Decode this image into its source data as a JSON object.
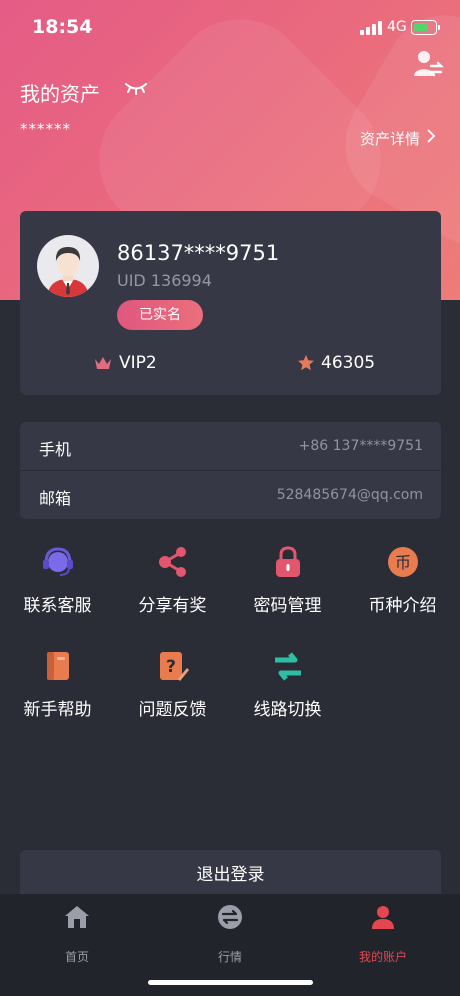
{
  "status_bar": {
    "time": "18:54",
    "network": "4G"
  },
  "header": {
    "title": "我的资产",
    "hidden_amount": "******",
    "detail_link": "资产详情"
  },
  "profile": {
    "phone": "86137****9751",
    "uid": "UID 136994",
    "verified_label": "已实名",
    "vip_level": "VIP2",
    "points": "46305"
  },
  "info_rows": [
    {
      "label": "手机",
      "value": "+86 137****9751"
    },
    {
      "label": "邮箱",
      "value": "528485674@qq.com"
    }
  ],
  "menu": [
    {
      "label": "联系客服",
      "icon": "headset-icon",
      "color": "#7b6be8"
    },
    {
      "label": "分享有奖",
      "icon": "share-icon",
      "color": "#e2566e"
    },
    {
      "label": "密码管理",
      "icon": "lock-icon",
      "color": "#e2566e"
    },
    {
      "label": "币种介绍",
      "icon": "currency-icon",
      "color": "#e87c4e"
    },
    {
      "label": "新手帮助",
      "icon": "book-icon",
      "color": "#e87c4e"
    },
    {
      "label": "问题反馈",
      "icon": "feedback-icon",
      "color": "#e87c4e"
    },
    {
      "label": "线路切换",
      "icon": "switch-line-icon",
      "color": "#2cbfa5"
    }
  ],
  "logout_label": "退出登录",
  "tabbar": {
    "items": [
      {
        "label": "首页",
        "icon": "home-icon",
        "active": false
      },
      {
        "label": "行情",
        "icon": "exchange-icon",
        "active": false
      },
      {
        "label": "我的账户",
        "icon": "account-icon",
        "active": true
      }
    ]
  },
  "colors": {
    "accent": "#e5474f",
    "card": "#363845",
    "background": "#2b2d36",
    "hero_start": "#e55b86",
    "hero_end": "#ee7c78"
  }
}
